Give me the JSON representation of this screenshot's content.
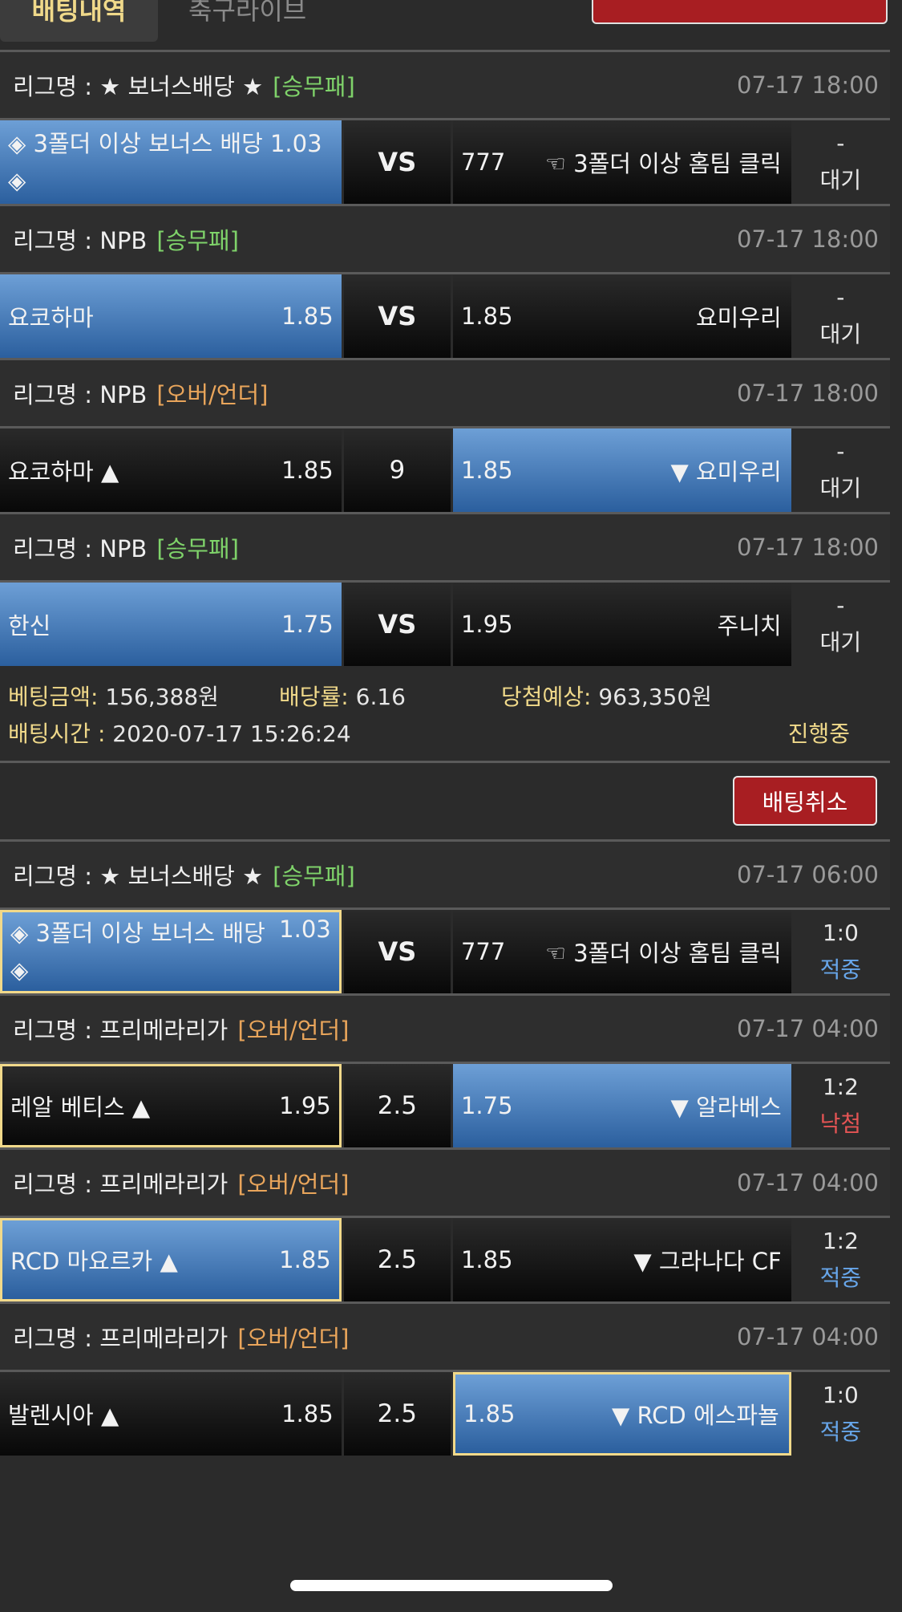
{
  "tabs": {
    "active": "배팅내역",
    "inactive": "축구라이브"
  },
  "group1": {
    "bets": [
      {
        "league": "리그명 : ★ 보너스배당 ★",
        "type": "[승무패]",
        "time": "07-17 18:00",
        "home": "◈ 3폴더 이상 보너스 배당 1.03 ◈",
        "home_odds": "",
        "mid": "VS",
        "away_odds": "777",
        "away": "☜ 3폴더 이상 홈팀 클릭",
        "res_score": "-",
        "res_status": "대기"
      },
      {
        "league": "리그명 : NPB",
        "type": "[승무패]",
        "time": "07-17 18:00",
        "home": "요코하마",
        "home_odds": "1.85",
        "mid": "VS",
        "away_odds": "1.85",
        "away": "요미우리",
        "res_score": "-",
        "res_status": "대기"
      },
      {
        "league": "리그명 : NPB",
        "type": "[오버/언더]",
        "time": "07-17 18:00",
        "home": "요코하마 ▲",
        "home_odds": "1.85",
        "mid": "9",
        "away_odds": "1.85",
        "away": "▼ 요미우리",
        "res_score": "-",
        "res_status": "대기"
      },
      {
        "league": "리그명 : NPB",
        "type": "[승무패]",
        "time": "07-17 18:00",
        "home": "한신",
        "home_odds": "1.75",
        "mid": "VS",
        "away_odds": "1.95",
        "away": "주니치",
        "res_score": "-",
        "res_status": "대기"
      }
    ],
    "summary": {
      "amount_label": "베팅금액:",
      "amount": "156,388원",
      "rate_label": "배당률:",
      "rate": "6.16",
      "expected_label": "당첨예상:",
      "expected": "963,350원",
      "time_label": "배팅시간 :",
      "time": "2020-07-17 15:26:24",
      "status": "진행중"
    }
  },
  "cancel_label": "배팅취소",
  "group2": {
    "bets": [
      {
        "league": "리그명 : ★ 보너스배당 ★",
        "type": "[승무패]",
        "time": "07-17 06:00",
        "home": "◈ 3폴더 이상 보너스 배당 ◈",
        "home_odds": "1.03",
        "mid": "VS",
        "away_odds": "777",
        "away": "☜ 3폴더 이상 홈팀 클릭",
        "res_score": "1:0",
        "res_status": "적중"
      },
      {
        "league": "리그명 : 프리메라리가",
        "type": "[오버/언더]",
        "time": "07-17 04:00",
        "home": "레알 베티스 ▲",
        "home_odds": "1.95",
        "mid": "2.5",
        "away_odds": "1.75",
        "away": "▼ 알라베스",
        "res_score": "1:2",
        "res_status": "낙첨"
      },
      {
        "league": "리그명 : 프리메라리가",
        "type": "[오버/언더]",
        "time": "07-17 04:00",
        "home": "RCD 마요르카 ▲",
        "home_odds": "1.85",
        "mid": "2.5",
        "away_odds": "1.85",
        "away": "▼ 그라나다 CF",
        "res_score": "1:2",
        "res_status": "적중"
      },
      {
        "league": "리그명 : 프리메라리가",
        "type": "[오버/언더]",
        "time": "07-17 04:00",
        "home": "발렌시아 ▲",
        "home_odds": "1.85",
        "mid": "2.5",
        "away_odds": "1.85",
        "away": "▼ RCD 에스파뇰",
        "res_score": "1:0",
        "res_status": "적중"
      }
    ]
  },
  "colors": {
    "selected": "#4a80bf",
    "hit": "#67a6ea",
    "miss": "#e45454",
    "green_tag": "#7fd36a",
    "orange_tag": "#e9a55b",
    "gold": "#f0d98a",
    "red_button": "#a81e22"
  }
}
